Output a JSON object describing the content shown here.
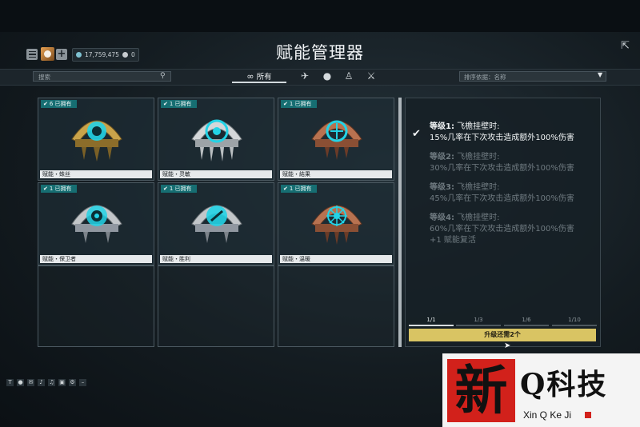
{
  "header": {
    "title": "赋能管理器",
    "credits": "17,759,475",
    "platinum": "0"
  },
  "filter": {
    "search_placeholder": "搜索",
    "tab_all": "所有",
    "sort_label": "排序依据：名称"
  },
  "cards": [
    {
      "owned": "6  已拥有",
      "label": "赋能・蛛丝",
      "metal": "#c9a34a",
      "accent": "#23d3e6"
    },
    {
      "owned": "1  已拥有",
      "label": "赋能・灵敏",
      "metal": "#d4d7d9",
      "accent": "#23d3e6"
    },
    {
      "owned": "1  已拥有",
      "label": "赋能・結果",
      "metal": "#b87250",
      "accent": "#23d3e6"
    },
    {
      "owned": "1  已拥有",
      "label": "赋能・保卫者",
      "metal": "#c2c6c9",
      "accent": "#23d3e6"
    },
    {
      "owned": "1  已拥有",
      "label": "赋能・胜利",
      "metal": "#c2c6c9",
      "accent": "#23d3e6"
    },
    {
      "owned": "1  已拥有",
      "label": "赋能・温暖",
      "metal": "#b87250",
      "accent": "#23d3e6"
    }
  ],
  "details": {
    "levels": [
      {
        "title": "等级1:",
        "trigger": "飞檐挂壁时:",
        "effect": "15%几率在下次攻击造成额外100%伤害",
        "active": true
      },
      {
        "title": "等级2:",
        "trigger": "飞檐挂壁时:",
        "effect": "30%几率在下次攻击造成额外100%伤害",
        "active": false
      },
      {
        "title": "等级3:",
        "trigger": "飞檐挂壁时:",
        "effect": "45%几率在下次攻击造成额外100%伤害",
        "active": false
      },
      {
        "title": "等级4:",
        "trigger": "飞檐挂壁时:",
        "effect": "60%几率在下次攻击造成额外100%伤害",
        "extra": "+1 赋能复活",
        "active": false
      }
    ],
    "ranks": [
      "1/1",
      "1/3",
      "1/6",
      "1/10"
    ],
    "upgrade_label": "升级还需2个"
  },
  "watermark": {
    "seal": "新",
    "title": "Q科技",
    "subtitle": "Xin Q Ke Ji"
  },
  "colors": {
    "accent": "#23d3e6",
    "badge": "#166e72",
    "upgrade": "#d9c463"
  }
}
